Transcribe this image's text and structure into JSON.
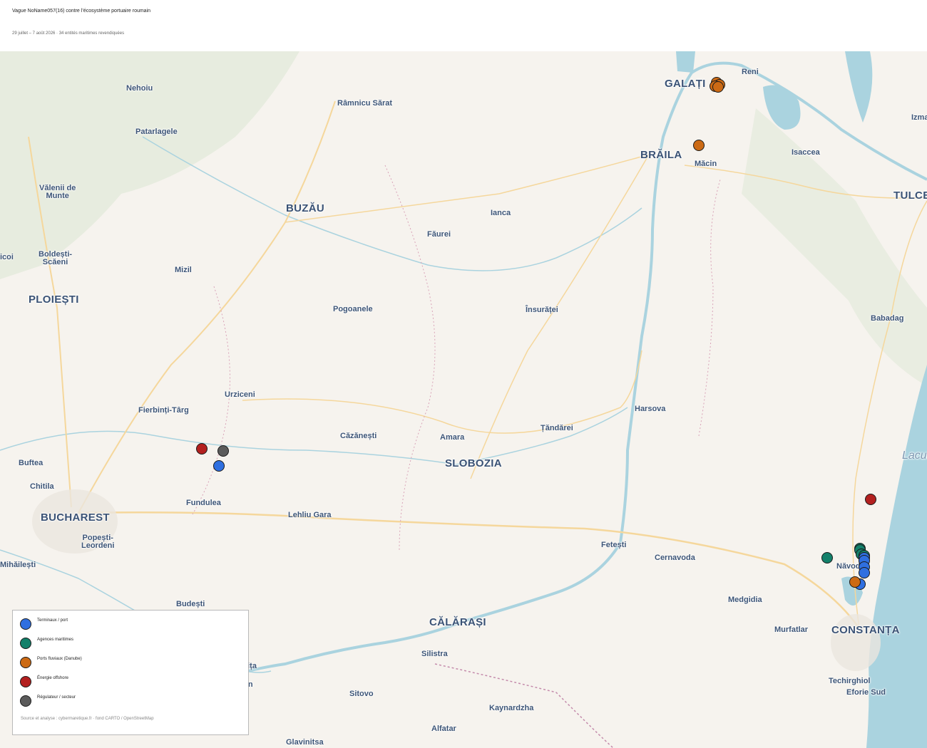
{
  "header": {
    "title": "Vague NoName057(16) contre l’écosystème portuaire roumain",
    "subtitle": "29 juillet – 7 août 2026 · 34 entités maritimes revendiquées"
  },
  "map": {
    "places": [
      {
        "name": "Nehoiu",
        "size": "town"
      },
      {
        "name": "Patarlagele",
        "size": "town"
      },
      {
        "name": "Râmnicu Sărat",
        "size": "town"
      },
      {
        "name": "Reni",
        "size": "town"
      },
      {
        "name": "Izma",
        "size": "town"
      },
      {
        "name": "Isaccea",
        "size": "town"
      },
      {
        "name": "Măcin",
        "size": "town"
      },
      {
        "name": "TULCEA",
        "size": "city"
      },
      {
        "name": "Vălenii de Munte",
        "size": "town"
      },
      {
        "name": "BUZĂU",
        "size": "city"
      },
      {
        "name": "Ianca",
        "size": "town"
      },
      {
        "name": "Făurei",
        "size": "town"
      },
      {
        "name": "icoi",
        "size": "town"
      },
      {
        "name": "Boldești-Scăeni",
        "size": "town"
      },
      {
        "name": "Mizil",
        "size": "town"
      },
      {
        "name": "PLOIEȘTI",
        "size": "city"
      },
      {
        "name": "Pogoanele",
        "size": "town"
      },
      {
        "name": "Însurăței",
        "size": "town"
      },
      {
        "name": "Babadag",
        "size": "town"
      },
      {
        "name": "Urziceni",
        "size": "town"
      },
      {
        "name": "Fierbinți-Târg",
        "size": "town"
      },
      {
        "name": "Harsova",
        "size": "town"
      },
      {
        "name": "Țăndărei",
        "size": "town"
      },
      {
        "name": "Căzănești",
        "size": "town"
      },
      {
        "name": "Amara",
        "size": "town"
      },
      {
        "name": "SLOBOZIA",
        "size": "city"
      },
      {
        "name": "Lacul S",
        "size": "water"
      },
      {
        "name": "Buftea",
        "size": "town"
      },
      {
        "name": "Chitila",
        "size": "town"
      },
      {
        "name": "Fundulea",
        "size": "town"
      },
      {
        "name": "BUCHAREST",
        "size": "city"
      },
      {
        "name": "Lehliu Gara",
        "size": "town"
      },
      {
        "name": "Popești-Leordeni",
        "size": "town"
      },
      {
        "name": "Fetești",
        "size": "town"
      },
      {
        "name": "Cernavoda",
        "size": "town"
      },
      {
        "name": "Năvodari",
        "size": "town"
      },
      {
        "name": "Mihăilești",
        "size": "town"
      },
      {
        "name": "Budești",
        "size": "town"
      },
      {
        "name": "Medgidia",
        "size": "town"
      },
      {
        "name": "CĂLĂRAȘI",
        "size": "city"
      },
      {
        "name": "Murfatlar",
        "size": "town"
      },
      {
        "name": "CONSTANȚA",
        "size": "city"
      },
      {
        "name": "Silistra",
        "size": "town"
      },
      {
        "name": "Oltenița",
        "size": "town"
      },
      {
        "name": "Tutrakan",
        "size": "town"
      },
      {
        "name": "Techirghiol",
        "size": "town"
      },
      {
        "name": "Eforie Sud",
        "size": "town"
      },
      {
        "name": "Sitovo",
        "size": "town"
      },
      {
        "name": "Kaynardzha",
        "size": "town"
      },
      {
        "name": "Alfatar",
        "size": "town"
      },
      {
        "name": "Glavinitsa",
        "size": "town"
      },
      {
        "name": "GALAȚI",
        "size": "city"
      },
      {
        "name": "BRĂILA",
        "size": "city"
      }
    ],
    "categories": [
      {
        "id": "terminal",
        "label": "Terminaux / port",
        "color": "#2f6fe0"
      },
      {
        "id": "agence",
        "label": "Agences maritimes",
        "color": "#13806a"
      },
      {
        "id": "fluvial",
        "label": "Ports fluviaux (Danube)",
        "color": "#cc6a14"
      },
      {
        "id": "energie",
        "label": "Énergie offshore",
        "color": "#b3201f"
      },
      {
        "id": "regulateur",
        "label": "Régulateur / secteur",
        "color": "#5b5b5b"
      }
    ],
    "markers": [
      {
        "cat": "fluvial",
        "lat": 45.437,
        "lon": 28.045
      },
      {
        "cat": "fluvial",
        "lat": 45.432,
        "lon": 28.055
      },
      {
        "cat": "fluvial",
        "lat": 45.427,
        "lon": 28.04
      },
      {
        "cat": "fluvial",
        "lat": 45.426,
        "lon": 28.05
      },
      {
        "cat": "fluvial",
        "lat": 45.27,
        "lon": 27.975
      },
      {
        "cat": "energie",
        "lat": 44.465,
        "lon": 26.0
      },
      {
        "cat": "regulateur",
        "lat": 44.458,
        "lon": 26.085
      },
      {
        "cat": "terminal",
        "lat": 44.42,
        "lon": 26.07
      },
      {
        "cat": "energie",
        "lat": 44.33,
        "lon": 28.655
      },
      {
        "cat": "agence",
        "lat": 44.2,
        "lon": 28.615
      },
      {
        "cat": "agence",
        "lat": 44.195,
        "lon": 28.615
      },
      {
        "cat": "agence",
        "lat": 44.185,
        "lon": 28.62
      },
      {
        "cat": "agence",
        "lat": 44.18,
        "lon": 28.63
      },
      {
        "cat": "agence",
        "lat": 44.175,
        "lon": 28.485
      },
      {
        "cat": "terminal",
        "lat": 44.175,
        "lon": 28.63
      },
      {
        "cat": "terminal",
        "lat": 44.168,
        "lon": 28.632
      },
      {
        "cat": "terminal",
        "lat": 44.15,
        "lon": 28.63
      },
      {
        "cat": "terminal",
        "lat": 44.135,
        "lon": 28.632
      },
      {
        "cat": "terminal",
        "lat": 44.105,
        "lon": 28.615
      },
      {
        "cat": "fluvial",
        "lat": 44.11,
        "lon": 28.595
      }
    ]
  },
  "legend": {
    "source": "Source et analyse : cybermaretique.fr · fond CARTO / OpenStreetMap"
  }
}
